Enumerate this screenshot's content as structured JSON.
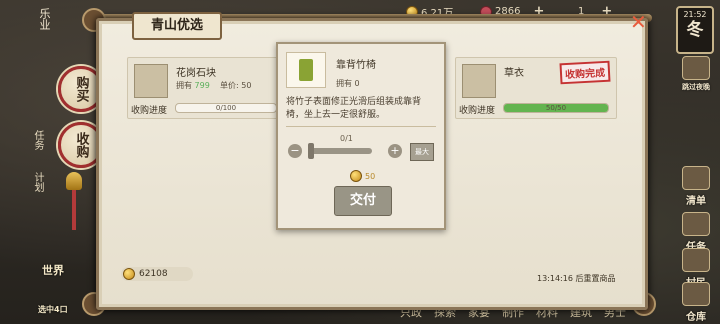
{
  "top": {
    "coins": "6.21万",
    "gems": "2866",
    "energy": "1",
    "plus": "+",
    "season_time": "21:52",
    "season": "冬",
    "skip_label": "跳过夜晚"
  },
  "left": {
    "tab_buy": "购买",
    "tab_sell": "收购",
    "label_task": "任务",
    "label_plan": "计划",
    "world": "世界",
    "bottom_label": "选中4口",
    "left_badge": "乐业"
  },
  "panel": {
    "title": "青山优选",
    "close": "✕",
    "cards": [
      {
        "name": "花岗石块",
        "owned_label": "拥有",
        "owned_value": "799",
        "price_label": "单价",
        "price_value": "50",
        "progress_label": "收购进度",
        "progress_text": "0/100",
        "progress": 0
      },
      {
        "name": "草衣",
        "progress_label": "收购进度",
        "progress_text": "50/50",
        "progress": 1,
        "stamp": "收购完成"
      }
    ],
    "coins_total": "62108",
    "restock": "13:14:16 后重置商品"
  },
  "popup": {
    "name": "靠背竹椅",
    "owned": "拥有 0",
    "desc": "将竹子表面修正光滑后组装成靠背椅，坐上去一定很舒服。",
    "qty": "0/1",
    "minus": "−",
    "plus": "+",
    "max": "最大",
    "price": "50",
    "deliver": "交付"
  },
  "right": [
    {
      "label": "清单"
    },
    {
      "label": "任务"
    },
    {
      "label": "村民"
    },
    {
      "label": "仓库"
    }
  ],
  "bottom_nav": [
    "只政",
    "探索",
    "家宴",
    "制作",
    "材料",
    "建筑",
    "男士"
  ],
  "colors": {
    "accent_red": "#c53333",
    "progress_green": "#63b44f",
    "close_orange": "#e85b3c"
  }
}
